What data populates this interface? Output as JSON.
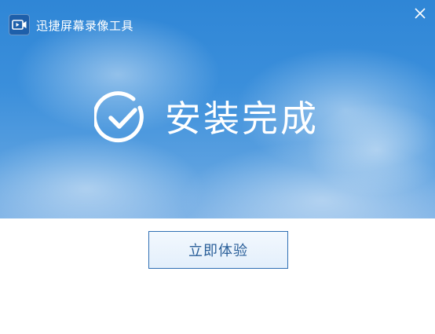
{
  "app": {
    "title": "迅捷屏幕录像工具",
    "icon": "video-camera-icon"
  },
  "window_controls": {
    "close_icon": "close-icon"
  },
  "status": {
    "icon": "check-circle-icon",
    "text": "安装完成"
  },
  "actions": {
    "start_label": "立即体验"
  },
  "colors": {
    "hero_top": "#2f86d6",
    "hero_bottom": "#7fb3e6",
    "button_border": "#2f6fb3",
    "button_text": "#2a5f99"
  }
}
